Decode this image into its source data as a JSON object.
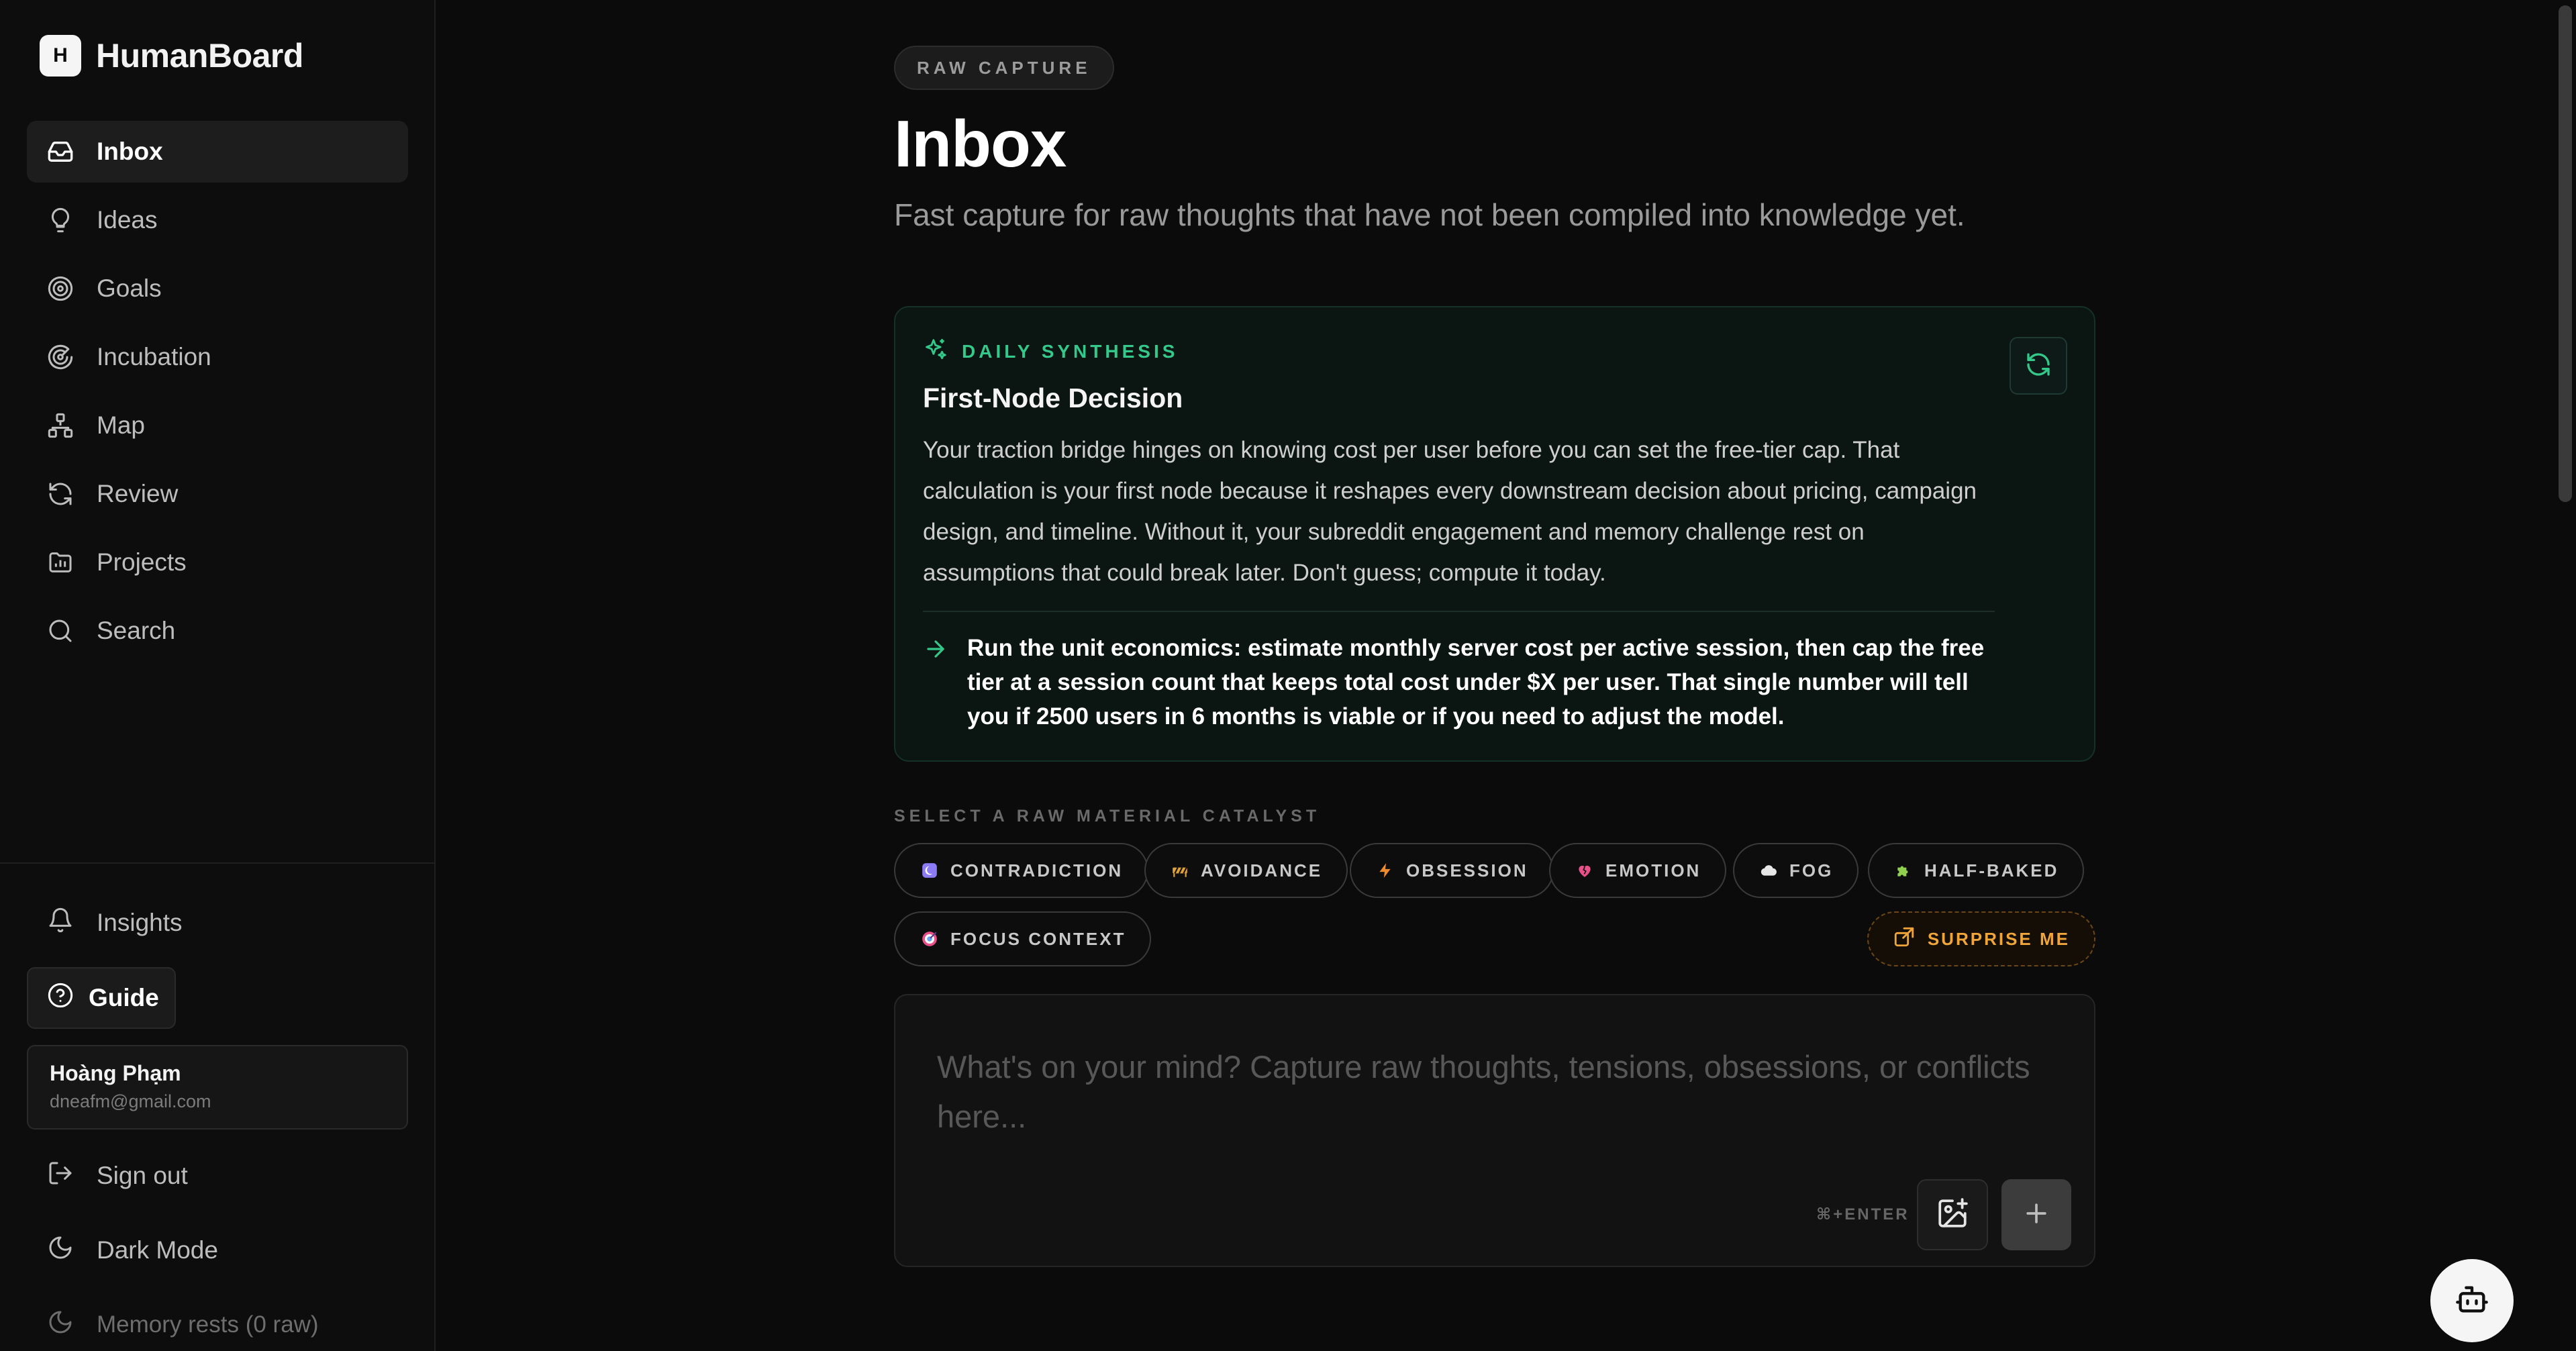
{
  "brand": {
    "logo_letter": "H",
    "name": "HumanBoard"
  },
  "sidebar": {
    "items": [
      {
        "label": "Inbox",
        "icon": "inbox-icon",
        "active": true
      },
      {
        "label": "Ideas",
        "icon": "lightbulb-icon"
      },
      {
        "label": "Goals",
        "icon": "target-icon"
      },
      {
        "label": "Incubation",
        "icon": "radar-icon"
      },
      {
        "label": "Map",
        "icon": "network-icon"
      },
      {
        "label": "Review",
        "icon": "refresh-icon"
      },
      {
        "label": "Projects",
        "icon": "folder-chart-icon"
      },
      {
        "label": "Search",
        "icon": "search-icon"
      }
    ],
    "insights_label": "Insights",
    "guide_label": "Guide",
    "user": {
      "name": "Hoàng Phạm",
      "email": "dneafm@gmail.com"
    },
    "sign_out_label": "Sign out",
    "dark_mode_label": "Dark Mode",
    "memory_label": "Memory rests (0 raw)"
  },
  "main": {
    "tag": "RAW CAPTURE",
    "title": "Inbox",
    "subtitle": "Fast capture for raw thoughts that have not been compiled into knowledge yet.",
    "synthesis": {
      "label": "DAILY SYNTHESIS",
      "title": "First-Node Decision",
      "body": "Your traction bridge hinges on knowing cost per user before you can set the free-tier cap. That calculation is your first node because it reshapes every downstream decision about pricing, campaign design, and timeline. Without it, your subreddit engagement and memory challenge rest on assumptions that could break later. Don't guess; compute it today.",
      "action": "Run the unit economics: estimate monthly server cost per active session, then cap the free tier at a session count that keeps total cost under $X per user. That single number will tell you if 2500 users in 6 months is viable or if you need to adjust the model."
    },
    "catalyst_label": "SELECT A RAW MATERIAL CATALYST",
    "catalysts": [
      {
        "label": "CONTRADICTION",
        "icon": "contradiction-icon",
        "color": "#8b7cf6"
      },
      {
        "label": "AVOIDANCE",
        "icon": "barrier-icon",
        "color": "#e0a23a"
      },
      {
        "label": "OBSESSION",
        "icon": "lightning-icon",
        "color": "#f08a2a"
      },
      {
        "label": "EMOTION",
        "icon": "broken-heart-icon",
        "color": "#e8508a"
      },
      {
        "label": "FOG",
        "icon": "cloud-icon",
        "color": "#e6e6e6"
      },
      {
        "label": "HALF-BAKED",
        "icon": "puzzle-icon",
        "color": "#8fd14f"
      },
      {
        "label": "FOCUS CONTEXT",
        "icon": "bullseye-icon",
        "color": "#e8508a"
      }
    ],
    "surprise_label": "SURPRISE ME",
    "capture": {
      "placeholder": "What's on your mind? Capture raw thoughts, tensions, obsessions, or conflicts here...",
      "shortcut": "⌘+ENTER"
    }
  },
  "colors": {
    "accent": "#34c98b",
    "surprise": "#f0a53a",
    "background": "#0b0b0b"
  }
}
